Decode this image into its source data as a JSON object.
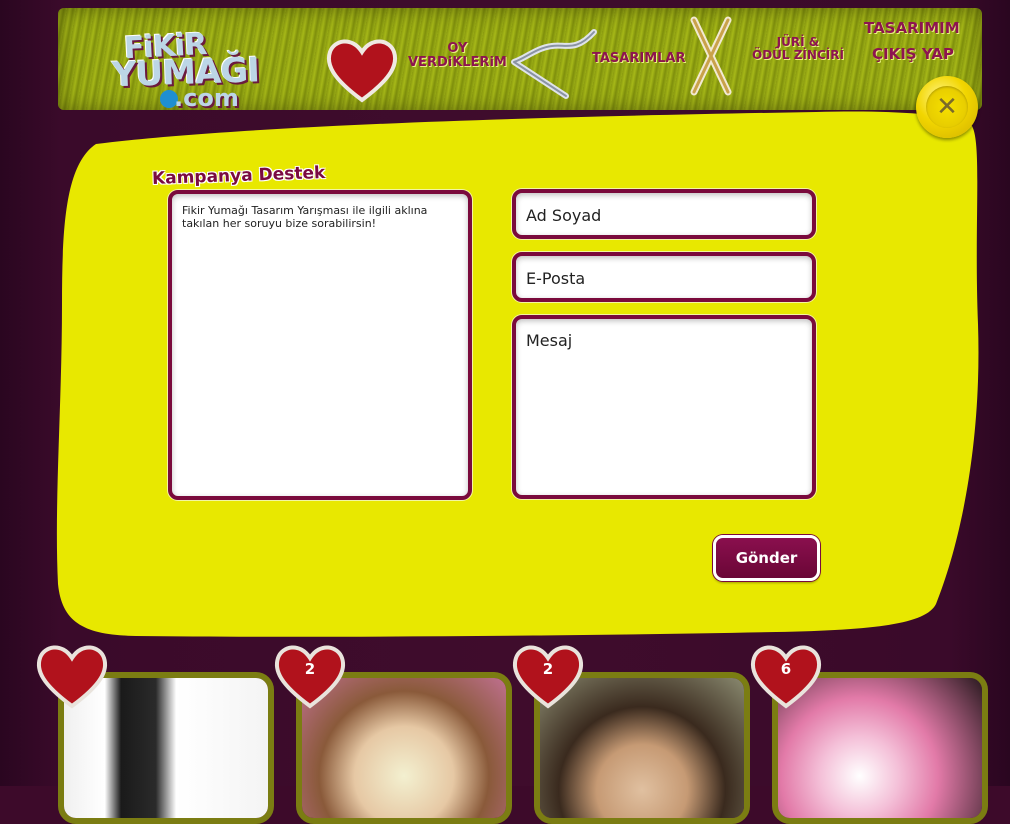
{
  "site": {
    "logo_line1": "FiKiR",
    "logo_line2": "YUMAĞI",
    "logo_line3": ".com"
  },
  "nav": {
    "votes_line1": "OY",
    "votes_line2": "VERDiKLERiM",
    "designs": "TASARIMLAR",
    "jury_line1": "JÜRİ &",
    "jury_line2": "ÖDÜL ZİNCİRİ",
    "my_design": "TASARIMIM",
    "logout": "ÇIKIŞ YAP"
  },
  "cards_bottom": [
    {
      "votes": ""
    },
    {
      "votes": "2"
    },
    {
      "votes": "2"
    },
    {
      "votes": "6"
    }
  ],
  "modal": {
    "title": "Kampanya Destek",
    "description": "Fikir Yumağı Tasarım Yarışması ile ilgili aklına takılan her soruyu bize sorabilirsin!",
    "name_placeholder": "Ad Soyad",
    "email_placeholder": "E-Posta",
    "message_placeholder": "Mesaj",
    "submit_label": "Gönder",
    "close_icon": "close-icon"
  },
  "colors": {
    "modal_yellow": "#e6e600",
    "maroon": "#7a0a3c",
    "background": "#3d0a2a"
  }
}
